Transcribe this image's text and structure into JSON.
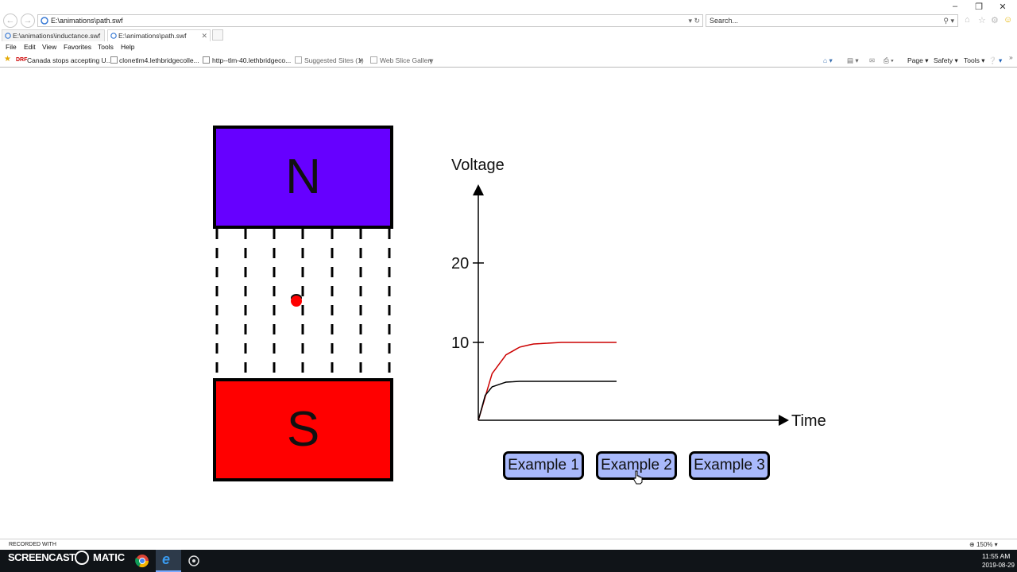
{
  "browser": {
    "address": "E:\\animations\\path.swf",
    "search_placeholder": "Search...",
    "tabs": [
      {
        "label": "E:\\animations\\inductance.swf",
        "active": false
      },
      {
        "label": "E:\\animations\\path.swf",
        "active": true
      }
    ],
    "menu": [
      "File",
      "Edit",
      "View",
      "Favorites",
      "Tools",
      "Help"
    ],
    "favorites": [
      {
        "label": "Canada stops accepting U...",
        "prefix": "DRF"
      },
      {
        "label": "clonetlm4.lethbridgecolle..."
      },
      {
        "label": "http--tlm-40.lethbridgeco..."
      },
      {
        "label": "Suggested Sites (1)"
      },
      {
        "label": "Web Slice Gallery"
      }
    ],
    "commandbar": {
      "page": "Page",
      "safety": "Safety",
      "tools": "Tools"
    },
    "zoom": "150%"
  },
  "animation": {
    "magnet_north_label": "N",
    "magnet_south_label": "S",
    "graph": {
      "y_label": "Voltage",
      "x_label": "Time",
      "y_ticks": [
        "20",
        "10"
      ],
      "curve_colors": {
        "series_1": "#cc0000",
        "series_2": "#000000"
      }
    },
    "buttons": [
      "Example 1",
      "Example 2",
      "Example 3"
    ],
    "colors": {
      "north": "#6600ff",
      "south": "#ff0000",
      "button_fill": "#a9b9fb",
      "charge": "#ff0000"
    }
  },
  "chart_data": {
    "type": "line",
    "title": "",
    "xlabel": "Time",
    "ylabel": "Voltage",
    "ylim": [
      0,
      20
    ],
    "yticks": [
      20,
      10
    ],
    "series": [
      {
        "x": [
          0,
          0.1,
          0.2,
          0.3,
          0.4,
          0.6,
          1.0
        ],
        "values": [
          0,
          6.0,
          8.4,
          9.4,
          9.8,
          10.0,
          10.0
        ]
      },
      {
        "x": [
          0,
          0.05,
          0.1,
          0.2,
          0.3,
          0.6,
          1.0
        ],
        "values": [
          0,
          3.2,
          4.3,
          4.9,
          5.0,
          5.0,
          5.0
        ]
      }
    ]
  },
  "taskbar": {
    "recorder_small": "RECORDED WITH",
    "recorder_big": "SCREENCAST",
    "recorder_tail": "MATIC",
    "time": "11:55 AM",
    "date": "2019-08-29"
  }
}
